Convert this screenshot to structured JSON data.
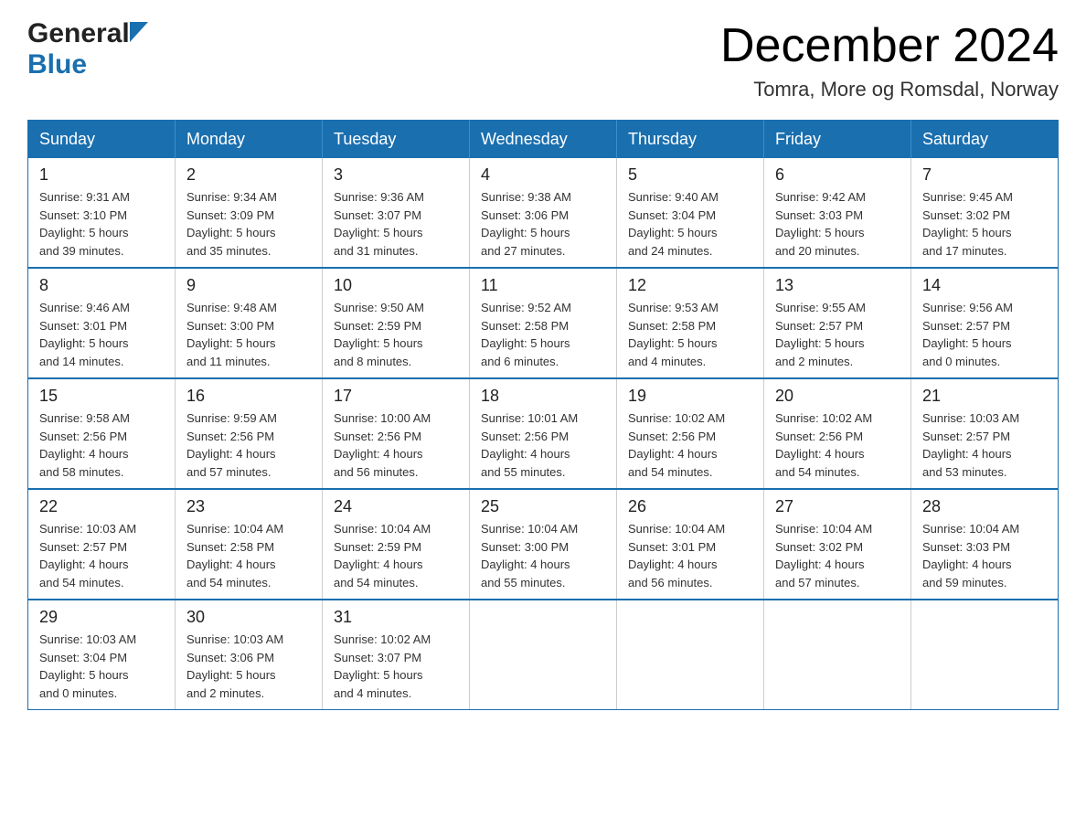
{
  "header": {
    "logo_general": "General",
    "logo_blue": "Blue",
    "month_title": "December 2024",
    "location": "Tomra, More og Romsdal, Norway"
  },
  "days_of_week": [
    "Sunday",
    "Monday",
    "Tuesday",
    "Wednesday",
    "Thursday",
    "Friday",
    "Saturday"
  ],
  "weeks": [
    [
      {
        "day": "1",
        "sunrise": "Sunrise: 9:31 AM",
        "sunset": "Sunset: 3:10 PM",
        "daylight": "Daylight: 5 hours",
        "daylight2": "and 39 minutes."
      },
      {
        "day": "2",
        "sunrise": "Sunrise: 9:34 AM",
        "sunset": "Sunset: 3:09 PM",
        "daylight": "Daylight: 5 hours",
        "daylight2": "and 35 minutes."
      },
      {
        "day": "3",
        "sunrise": "Sunrise: 9:36 AM",
        "sunset": "Sunset: 3:07 PM",
        "daylight": "Daylight: 5 hours",
        "daylight2": "and 31 minutes."
      },
      {
        "day": "4",
        "sunrise": "Sunrise: 9:38 AM",
        "sunset": "Sunset: 3:06 PM",
        "daylight": "Daylight: 5 hours",
        "daylight2": "and 27 minutes."
      },
      {
        "day": "5",
        "sunrise": "Sunrise: 9:40 AM",
        "sunset": "Sunset: 3:04 PM",
        "daylight": "Daylight: 5 hours",
        "daylight2": "and 24 minutes."
      },
      {
        "day": "6",
        "sunrise": "Sunrise: 9:42 AM",
        "sunset": "Sunset: 3:03 PM",
        "daylight": "Daylight: 5 hours",
        "daylight2": "and 20 minutes."
      },
      {
        "day": "7",
        "sunrise": "Sunrise: 9:45 AM",
        "sunset": "Sunset: 3:02 PM",
        "daylight": "Daylight: 5 hours",
        "daylight2": "and 17 minutes."
      }
    ],
    [
      {
        "day": "8",
        "sunrise": "Sunrise: 9:46 AM",
        "sunset": "Sunset: 3:01 PM",
        "daylight": "Daylight: 5 hours",
        "daylight2": "and 14 minutes."
      },
      {
        "day": "9",
        "sunrise": "Sunrise: 9:48 AM",
        "sunset": "Sunset: 3:00 PM",
        "daylight": "Daylight: 5 hours",
        "daylight2": "and 11 minutes."
      },
      {
        "day": "10",
        "sunrise": "Sunrise: 9:50 AM",
        "sunset": "Sunset: 2:59 PM",
        "daylight": "Daylight: 5 hours",
        "daylight2": "and 8 minutes."
      },
      {
        "day": "11",
        "sunrise": "Sunrise: 9:52 AM",
        "sunset": "Sunset: 2:58 PM",
        "daylight": "Daylight: 5 hours",
        "daylight2": "and 6 minutes."
      },
      {
        "day": "12",
        "sunrise": "Sunrise: 9:53 AM",
        "sunset": "Sunset: 2:58 PM",
        "daylight": "Daylight: 5 hours",
        "daylight2": "and 4 minutes."
      },
      {
        "day": "13",
        "sunrise": "Sunrise: 9:55 AM",
        "sunset": "Sunset: 2:57 PM",
        "daylight": "Daylight: 5 hours",
        "daylight2": "and 2 minutes."
      },
      {
        "day": "14",
        "sunrise": "Sunrise: 9:56 AM",
        "sunset": "Sunset: 2:57 PM",
        "daylight": "Daylight: 5 hours",
        "daylight2": "and 0 minutes."
      }
    ],
    [
      {
        "day": "15",
        "sunrise": "Sunrise: 9:58 AM",
        "sunset": "Sunset: 2:56 PM",
        "daylight": "Daylight: 4 hours",
        "daylight2": "and 58 minutes."
      },
      {
        "day": "16",
        "sunrise": "Sunrise: 9:59 AM",
        "sunset": "Sunset: 2:56 PM",
        "daylight": "Daylight: 4 hours",
        "daylight2": "and 57 minutes."
      },
      {
        "day": "17",
        "sunrise": "Sunrise: 10:00 AM",
        "sunset": "Sunset: 2:56 PM",
        "daylight": "Daylight: 4 hours",
        "daylight2": "and 56 minutes."
      },
      {
        "day": "18",
        "sunrise": "Sunrise: 10:01 AM",
        "sunset": "Sunset: 2:56 PM",
        "daylight": "Daylight: 4 hours",
        "daylight2": "and 55 minutes."
      },
      {
        "day": "19",
        "sunrise": "Sunrise: 10:02 AM",
        "sunset": "Sunset: 2:56 PM",
        "daylight": "Daylight: 4 hours",
        "daylight2": "and 54 minutes."
      },
      {
        "day": "20",
        "sunrise": "Sunrise: 10:02 AM",
        "sunset": "Sunset: 2:56 PM",
        "daylight": "Daylight: 4 hours",
        "daylight2": "and 54 minutes."
      },
      {
        "day": "21",
        "sunrise": "Sunrise: 10:03 AM",
        "sunset": "Sunset: 2:57 PM",
        "daylight": "Daylight: 4 hours",
        "daylight2": "and 53 minutes."
      }
    ],
    [
      {
        "day": "22",
        "sunrise": "Sunrise: 10:03 AM",
        "sunset": "Sunset: 2:57 PM",
        "daylight": "Daylight: 4 hours",
        "daylight2": "and 54 minutes."
      },
      {
        "day": "23",
        "sunrise": "Sunrise: 10:04 AM",
        "sunset": "Sunset: 2:58 PM",
        "daylight": "Daylight: 4 hours",
        "daylight2": "and 54 minutes."
      },
      {
        "day": "24",
        "sunrise": "Sunrise: 10:04 AM",
        "sunset": "Sunset: 2:59 PM",
        "daylight": "Daylight: 4 hours",
        "daylight2": "and 54 minutes."
      },
      {
        "day": "25",
        "sunrise": "Sunrise: 10:04 AM",
        "sunset": "Sunset: 3:00 PM",
        "daylight": "Daylight: 4 hours",
        "daylight2": "and 55 minutes."
      },
      {
        "day": "26",
        "sunrise": "Sunrise: 10:04 AM",
        "sunset": "Sunset: 3:01 PM",
        "daylight": "Daylight: 4 hours",
        "daylight2": "and 56 minutes."
      },
      {
        "day": "27",
        "sunrise": "Sunrise: 10:04 AM",
        "sunset": "Sunset: 3:02 PM",
        "daylight": "Daylight: 4 hours",
        "daylight2": "and 57 minutes."
      },
      {
        "day": "28",
        "sunrise": "Sunrise: 10:04 AM",
        "sunset": "Sunset: 3:03 PM",
        "daylight": "Daylight: 4 hours",
        "daylight2": "and 59 minutes."
      }
    ],
    [
      {
        "day": "29",
        "sunrise": "Sunrise: 10:03 AM",
        "sunset": "Sunset: 3:04 PM",
        "daylight": "Daylight: 5 hours",
        "daylight2": "and 0 minutes."
      },
      {
        "day": "30",
        "sunrise": "Sunrise: 10:03 AM",
        "sunset": "Sunset: 3:06 PM",
        "daylight": "Daylight: 5 hours",
        "daylight2": "and 2 minutes."
      },
      {
        "day": "31",
        "sunrise": "Sunrise: 10:02 AM",
        "sunset": "Sunset: 3:07 PM",
        "daylight": "Daylight: 5 hours",
        "daylight2": "and 4 minutes."
      },
      null,
      null,
      null,
      null
    ]
  ]
}
